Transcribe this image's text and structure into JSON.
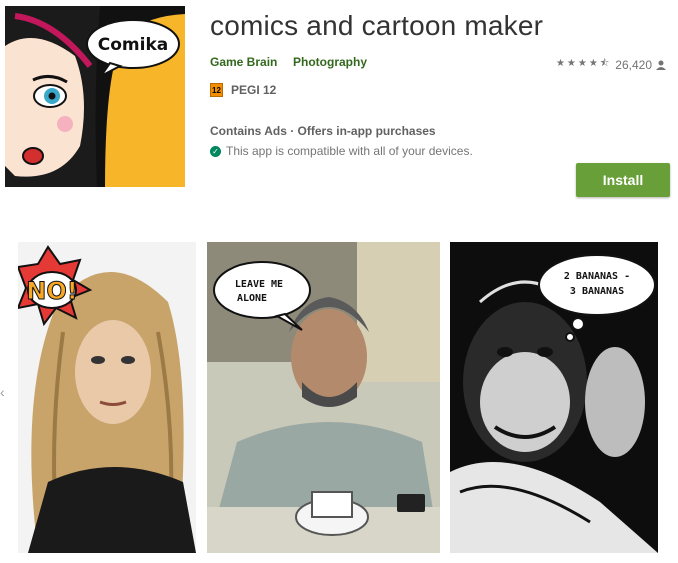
{
  "app": {
    "title": "comics and cartoon maker",
    "developer": "Game Brain",
    "category": "Photography",
    "rating_count": "26,420",
    "rating_stars": 4.5,
    "content_rating": "PEGI 12",
    "pegi_badge": "12",
    "ads_notice": "Contains Ads · Offers in-app purchases",
    "compat_notice": "This app is compatible with all of your devices.",
    "install_label": "Install"
  },
  "icon": {
    "bubble_text": "Comika"
  },
  "screenshots": [
    {
      "bubble_text": "NO!"
    },
    {
      "bubble_line1": "LEAVE ME",
      "bubble_line2": "ALONE"
    },
    {
      "bubble_line1": "2 BANANAS -",
      "bubble_line2": "3 BANANAS"
    }
  ],
  "colors": {
    "accent_green": "#689f38",
    "link_green": "#33691e",
    "icon_bg": "#f7b52a"
  },
  "icons": [
    "star-icon",
    "person-icon",
    "check-icon",
    "chevron-left-icon"
  ]
}
